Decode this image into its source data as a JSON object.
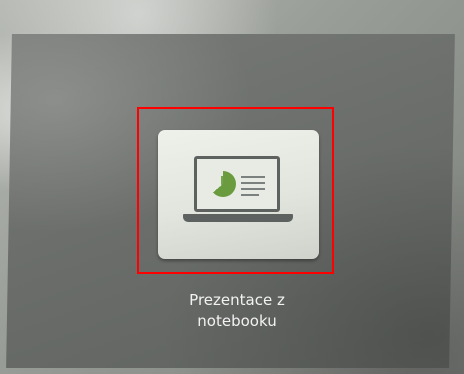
{
  "tile": {
    "label_line1": "Prezentace z",
    "label_line2": "notebooku",
    "icon": "laptop-presentation-icon"
  },
  "colors": {
    "highlight": "#ff0000",
    "tile": "#e6e9e2",
    "screen": "#6c6f6c",
    "chart_accent": "#6a9c3f"
  }
}
